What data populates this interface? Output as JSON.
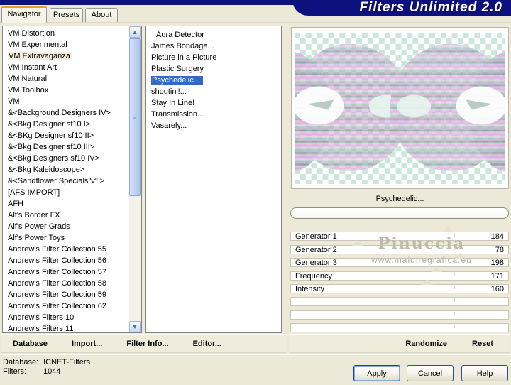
{
  "window": {
    "title_logo": "Filters Unlimited 2.0"
  },
  "tabs": [
    {
      "label": "Navigator",
      "active": true
    },
    {
      "label": "Presets",
      "active": false
    },
    {
      "label": "About",
      "active": false
    }
  ],
  "category_list": {
    "selected_index": 2,
    "items": [
      "VM Distortion",
      "VM Experimental",
      "VM Extravaganza",
      "VM Instant Art",
      "VM Natural",
      "VM Toolbox",
      "VM",
      "&<Background Designers IV>",
      "&<Bkg Designer sf10 I>",
      "&<BKg Designer sf10 II>",
      "&<Bkg Designer sf10 III>",
      "&<Bkg Designers sf10 IV>",
      "&<Bkg Kaleidoscope>",
      "&<Sandflower Specials\"v\" >",
      "[AFS IMPORT]",
      "AFH",
      "Alf's Border FX",
      "Alf's Power Grads",
      "Alf's Power Toys",
      "Andrew's Filter Collection 55",
      "Andrew's Filter Collection 56",
      "Andrew's Filter Collection 57",
      "Andrew's Filter Collection 58",
      "Andrew's Filter Collection 59",
      "Andrew's Filter Collection 62",
      "Andrew's Filters 10",
      "Andrew's Filters 11"
    ]
  },
  "filter_list": {
    "selected_index": 4,
    "items": [
      {
        "label": "Aura Detector",
        "indent": true
      },
      {
        "label": "James Bondage...",
        "indent": false
      },
      {
        "label": "Picture in a Picture",
        "indent": false
      },
      {
        "label": "Plastic Surgery",
        "indent": false
      },
      {
        "label": "Psychedelic...",
        "indent": false
      },
      {
        "label": "shoutin'!...",
        "indent": false
      },
      {
        "label": "Stay In Line!",
        "indent": false
      },
      {
        "label": "Transmission...",
        "indent": false
      },
      {
        "label": "Vasarely...",
        "indent": false
      }
    ]
  },
  "preview": {
    "caption": "Psychedelic...",
    "watermark_title": "Pinuccia",
    "watermark_url": "www.maidiregrafica.eu"
  },
  "sliders": {
    "max": 255,
    "empty_rows": 3,
    "items": [
      {
        "label": "Generator 1",
        "value": 184
      },
      {
        "label": "Generator 2",
        "value": 78
      },
      {
        "label": "Generator 3",
        "value": 198
      },
      {
        "label": "Frequency",
        "value": 171
      },
      {
        "label": "Intensity",
        "value": 160
      }
    ]
  },
  "menus": {
    "left": [
      {
        "name": "database",
        "pre": "",
        "u": "D",
        "post": "atabase"
      },
      {
        "name": "import",
        "pre": "I",
        "u": "m",
        "post": "port..."
      },
      {
        "name": "filter-info",
        "pre": "Filter ",
        "u": "I",
        "post": "nfo..."
      },
      {
        "name": "editor",
        "pre": "",
        "u": "E",
        "post": "ditor..."
      }
    ],
    "right": [
      {
        "name": "randomize",
        "label": "Randomize"
      },
      {
        "name": "reset",
        "label": "Reset"
      }
    ]
  },
  "status": {
    "database_label": "Database:",
    "database_value": "ICNET-Filters",
    "filters_label": "Filters:",
    "filters_value": "1044"
  },
  "action_buttons": [
    {
      "label": "Apply",
      "default": true
    },
    {
      "label": "Cancel",
      "default": false
    },
    {
      "label": "Help",
      "default": false
    }
  ],
  "icons": {
    "scroll_up": "▲",
    "scroll_down": "▼",
    "thumb_grip": "≡"
  },
  "colors": {
    "titlebar": "#0D117E",
    "selection_blue": "#316AC5",
    "category_highlight": "#F2EFDE",
    "tab_accent_orange": "#E8A020",
    "dialog_bg": "#ECE9D8"
  }
}
